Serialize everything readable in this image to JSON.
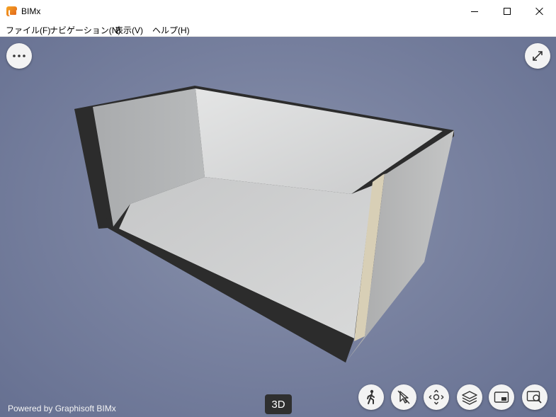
{
  "window": {
    "title": "BIMx"
  },
  "menu": [
    {
      "label": "ファイル(F)"
    },
    {
      "label": "ナビゲーション(N)"
    },
    {
      "label": "表示(V)"
    },
    {
      "label": "ヘルプ(H)"
    }
  ],
  "viewer": {
    "mode": "3D",
    "powered_by": "Powered by Graphisoft BIMx",
    "toolbar": [
      {
        "icon": "walk-icon"
      },
      {
        "icon": "select-cursor-icon"
      },
      {
        "icon": "orbit-icon"
      },
      {
        "icon": "layers-icon"
      },
      {
        "icon": "saved-views-icon"
      },
      {
        "icon": "zoom-icon"
      }
    ],
    "top_controls": [
      {
        "icon": "more-options-icon"
      },
      {
        "icon": "expand-icon"
      }
    ]
  },
  "colors": {
    "background": "#7982a0",
    "wall": "#c9cacb",
    "wall_dark": "#2c2c2c",
    "door_frame": "#d8cfb6",
    "button": "#f3f3f3",
    "badge": "#2f2f2f"
  }
}
